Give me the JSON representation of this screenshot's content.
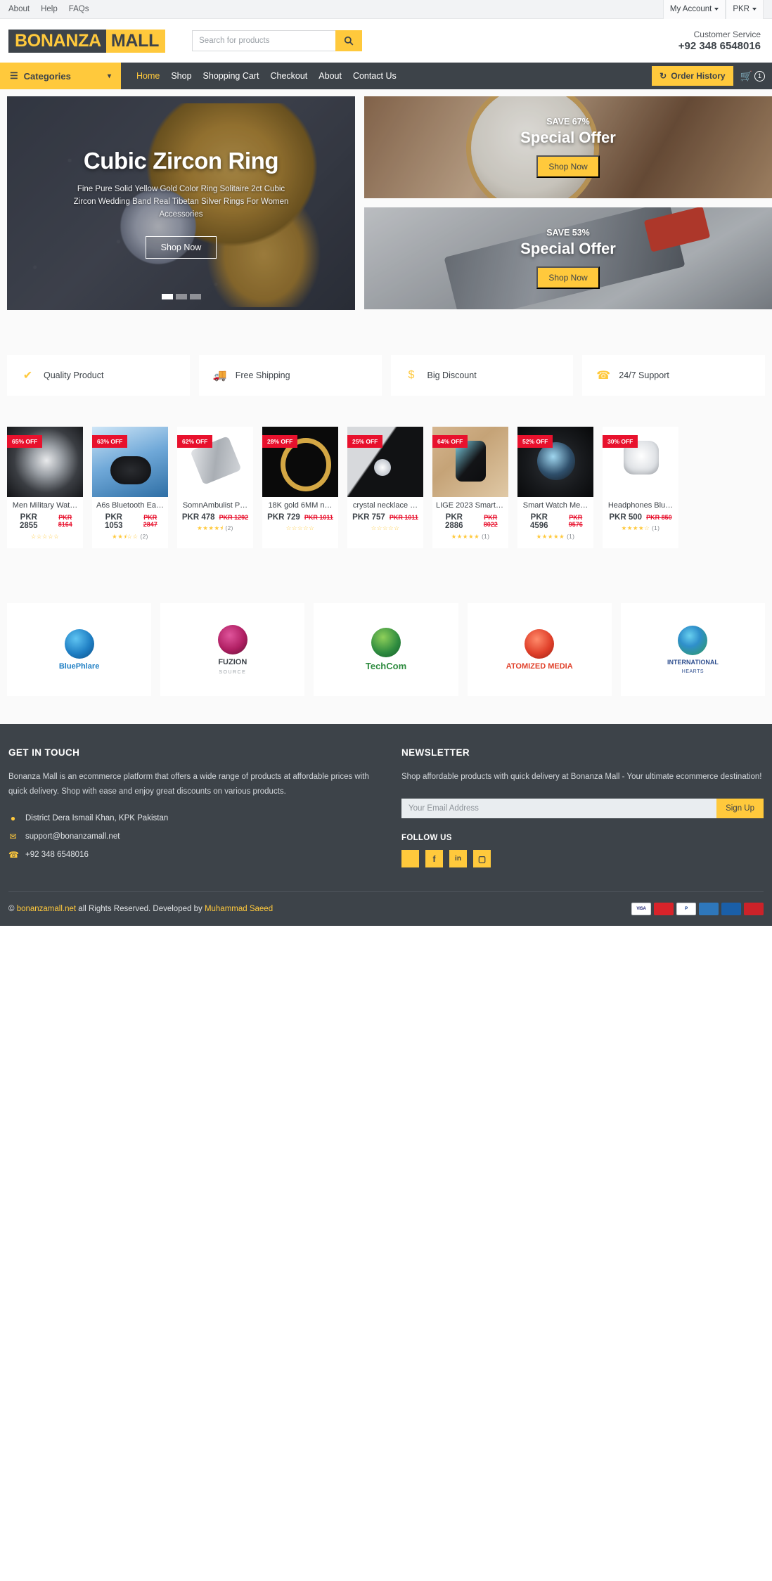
{
  "topbar": {
    "links": [
      "About",
      "Help",
      "FAQs"
    ],
    "account": "My Account",
    "currency": "PKR"
  },
  "header": {
    "logo_part1": "BONANZA",
    "logo_part2": "MALL",
    "search_placeholder": "Search for products",
    "search_value": "",
    "search_icon": "search-icon",
    "customer_service_label": "Customer Service",
    "customer_service_number": "+92 348 6548016"
  },
  "nav": {
    "categories_label": "Categories",
    "links": [
      "Home",
      "Shop",
      "Shopping Cart",
      "Checkout",
      "About",
      "Contact Us"
    ],
    "active_link": "Home",
    "order_history_label": "Order History",
    "cart_count": "1"
  },
  "hero": {
    "title": "Cubic Zircon Ring",
    "description": "Fine Pure Solid Yellow Gold Color Ring Solitaire 2ct Cubic Zircon Wedding Band Real Tibetan Silver Rings For Women Accessories",
    "button": "Shop Now",
    "slides": 3,
    "active_slide": 1
  },
  "side_banners": [
    {
      "save": "SAVE 67%",
      "title": "Special Offer",
      "button": "Shop Now"
    },
    {
      "save": "SAVE 53%",
      "title": "Special Offer",
      "button": "Shop Now"
    }
  ],
  "features": [
    {
      "icon": "check-icon",
      "label": "Quality Product"
    },
    {
      "icon": "truck-icon",
      "label": "Free Shipping"
    },
    {
      "icon": "dollar-icon",
      "label": "Big Discount"
    },
    {
      "icon": "phone-icon",
      "label": "24/7 Support"
    }
  ],
  "products": [
    {
      "name": "Men Military Wat…",
      "discount": "65% OFF",
      "price": "PKR 2855",
      "old_price": "PKR 8164",
      "rating": 0,
      "reviews": ""
    },
    {
      "name": "A6s Bluetooth Ea…",
      "discount": "63% OFF",
      "price": "PKR 1053",
      "old_price": "PKR 2847",
      "rating": 2.5,
      "reviews": "(2)"
    },
    {
      "name": "SomnAmbulist P…",
      "discount": "62% OFF",
      "price": "PKR 478",
      "old_price": "PKR 1292",
      "rating": 4.5,
      "reviews": "(2)"
    },
    {
      "name": "18K gold 6MM n…",
      "discount": "28% OFF",
      "price": "PKR 729",
      "old_price": "PKR 1011",
      "rating": 0,
      "reviews": ""
    },
    {
      "name": "crystal necklace …",
      "discount": "25% OFF",
      "price": "PKR 757",
      "old_price": "PKR 1011",
      "rating": 0,
      "reviews": ""
    },
    {
      "name": "LIGE 2023 Smart …",
      "discount": "64% OFF",
      "price": "PKR 2886",
      "old_price": "PKR 8022",
      "rating": 5,
      "reviews": "(1)"
    },
    {
      "name": "Smart Watch Me…",
      "discount": "52% OFF",
      "price": "PKR 4596",
      "old_price": "PKR 9576",
      "rating": 5,
      "reviews": "(1)"
    },
    {
      "name": "Headphones Blu…",
      "discount": "30% OFF",
      "price": "PKR 500",
      "old_price": "PKR 850",
      "rating": 4,
      "reviews": "(1)"
    }
  ],
  "brands": [
    {
      "name": "BluePhlare",
      "sub": ""
    },
    {
      "name": "FUZION",
      "sub": "SOURCE"
    },
    {
      "name": "TechCom",
      "sub": ""
    },
    {
      "name": "ATOMIZED MEDIA",
      "sub": ""
    },
    {
      "name": "INTERNATIONAL",
      "sub": "HEARTS"
    }
  ],
  "footer": {
    "get_in_touch_title": "GET IN TOUCH",
    "about_text": "Bonanza Mall is an ecommerce platform that offers a wide range of products at affordable prices with quick delivery. Shop with ease and enjoy great discounts on various products.",
    "address": "District Dera Ismail Khan, KPK Pakistan",
    "email": "support@bonanzamall.net",
    "phone": "+92 348 6548016",
    "newsletter_title": "NEWSLETTER",
    "newsletter_text": "Shop affordable products with quick delivery at Bonanza Mall - Your ultimate ecommerce destination!",
    "email_placeholder": "Your Email Address",
    "email_value": "",
    "signup_label": "Sign Up",
    "follow_us_title": "FOLLOW US",
    "socials": [
      "twitter-icon",
      "facebook-icon",
      "linkedin-icon",
      "instagram-icon"
    ],
    "copyright_prefix": "©",
    "copyright_site": "bonanzamall.net",
    "copyright_mid": "all Rights Reserved. Developed by",
    "copyright_dev": "Muhammad Saeed",
    "payments": [
      "VISA",
      "MasterCard",
      "PayPal",
      "AMERICAN EXPRESS",
      "VISA Electron",
      "Maestro"
    ]
  },
  "colors": {
    "accent": "#ffc93c",
    "dark": "#3d4349",
    "danger": "#e8112d"
  }
}
